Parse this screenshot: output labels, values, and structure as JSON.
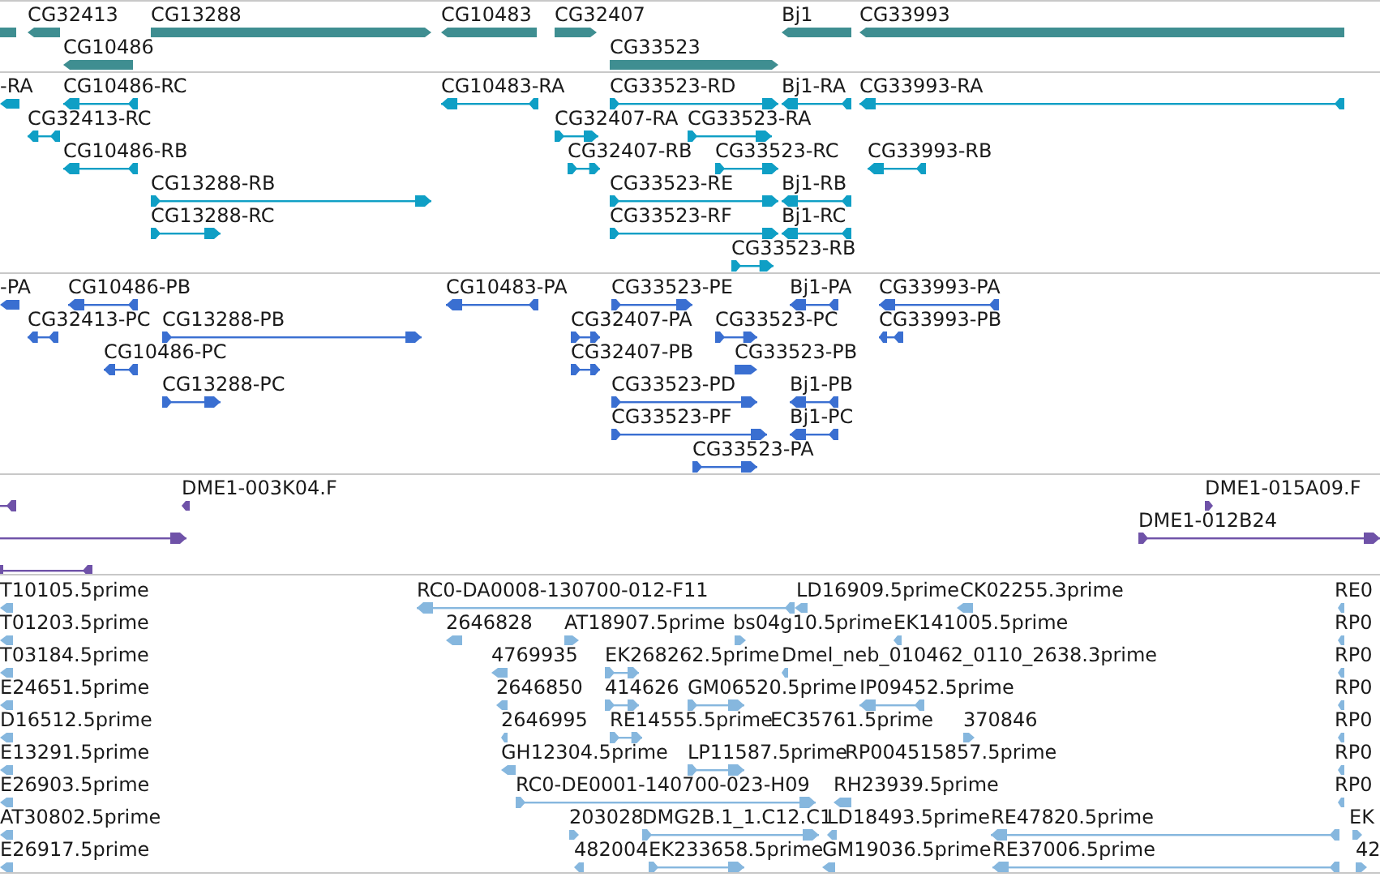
{
  "tracks": [
    {
      "kind": "genes",
      "color": "#3f8e91",
      "features": [
        {
          "clipped": true
        },
        {
          "label": "CG32413"
        },
        {
          "label": "CG13288"
        },
        {
          "label": "CG10483"
        },
        {
          "label": "CG32407"
        },
        {
          "label": "Bj1"
        },
        {
          "label": "CG33993"
        },
        {
          "label": "CG10486"
        },
        {
          "label": "CG33523"
        }
      ]
    },
    {
      "kind": "transcripts",
      "color": "#0f9fc5",
      "features": [
        {
          "label": "-RA"
        },
        {
          "label": "CG10486-RC"
        },
        {
          "label": "CG10483-RA"
        },
        {
          "label": "CG33523-RD"
        },
        {
          "label": "Bj1-RA"
        },
        {
          "label": "CG33993-RA"
        },
        {
          "label": "CG32413-RC"
        },
        {
          "label": "CG32407-RA"
        },
        {
          "label": "CG33523-RA"
        },
        {
          "label": "CG10486-RB"
        },
        {
          "label": "CG32407-RB"
        },
        {
          "label": "CG33523-RC"
        },
        {
          "label": "CG33993-RB"
        },
        {
          "label": "CG13288-RB"
        },
        {
          "label": "CG33523-RE"
        },
        {
          "label": "Bj1-RB"
        },
        {
          "label": "CG13288-RC"
        },
        {
          "label": "CG33523-RF"
        },
        {
          "label": "Bj1-RC"
        },
        {
          "label": "CG33523-RB"
        }
      ]
    },
    {
      "kind": "proteins",
      "color": "#3a6fd1",
      "features": [
        {
          "label": "-PA"
        },
        {
          "label": "CG10486-PB"
        },
        {
          "label": "CG10483-PA"
        },
        {
          "label": "CG33523-PE"
        },
        {
          "label": "Bj1-PA"
        },
        {
          "label": "CG33993-PA"
        },
        {
          "label": "CG32413-PC"
        },
        {
          "label": "CG13288-PB"
        },
        {
          "label": "CG32407-PA"
        },
        {
          "label": "CG33523-PC"
        },
        {
          "label": "CG33993-PB"
        },
        {
          "label": "CG10486-PC"
        },
        {
          "label": "CG32407-PB"
        },
        {
          "label": "CG33523-PB"
        },
        {
          "label": "CG13288-PC"
        },
        {
          "label": "CG33523-PD"
        },
        {
          "label": "Bj1-PB"
        },
        {
          "label": "CG33523-PF"
        },
        {
          "label": "Bj1-PC"
        },
        {
          "label": "CG33523-PA"
        }
      ]
    },
    {
      "kind": "clones",
      "color": "#6f52a8",
      "features": [
        {
          "clipped": true
        },
        {
          "label": "DME1-003K04.F"
        },
        {
          "label": "DME1-015A09.F"
        },
        {
          "clipped": true
        },
        {
          "label": "DME1-012B24"
        },
        {
          "clipped": true
        }
      ]
    },
    {
      "kind": "ests",
      "color": "#86b7de",
      "features": [
        {
          "label": "T10105.5prime"
        },
        {
          "label": "RC0-DA0008-130700-012-F11"
        },
        {
          "label": "LD16909.5prime"
        },
        {
          "label": "CK02255.3prime"
        },
        {
          "label": "RE0"
        },
        {
          "label": "T01203.5prime"
        },
        {
          "label": "2646828"
        },
        {
          "label": "AT18907.5prime"
        },
        {
          "label": "bs04g10.5prime"
        },
        {
          "label": "EK141005.5prime"
        },
        {
          "label": "RP0"
        },
        {
          "label": "T03184.5prime"
        },
        {
          "label": "4769935"
        },
        {
          "label": "EK268262.5prime"
        },
        {
          "label": "Dmel_neb_010462_0110_2638.3prime"
        },
        {
          "label": "RP0"
        },
        {
          "label": "E24651.5prime"
        },
        {
          "label": "2646850"
        },
        {
          "label": "414626"
        },
        {
          "label": "GM06520.5prime"
        },
        {
          "label": "IP09452.5prime"
        },
        {
          "label": "RP0"
        },
        {
          "label": "D16512.5prime"
        },
        {
          "label": "2646995"
        },
        {
          "label": "RE14555.5prime"
        },
        {
          "label": "EC35761.5prime"
        },
        {
          "label": "370846"
        },
        {
          "label": "RP0"
        },
        {
          "label": "E13291.5prime"
        },
        {
          "label": "GH12304.5prime"
        },
        {
          "label": "LP11587.5prime"
        },
        {
          "label": "RP004515857.5prime"
        },
        {
          "label": "RP0"
        },
        {
          "label": "E26903.5prime"
        },
        {
          "label": "RC0-DE0001-140700-023-H09"
        },
        {
          "label": "RH23939.5prime"
        },
        {
          "label": "RP0"
        },
        {
          "label": "AT30802.5prime"
        },
        {
          "label": "203028"
        },
        {
          "label": "DMG2B.1_1.C12.C1"
        },
        {
          "label": "LD18493.5prime"
        },
        {
          "label": "RE47820.5prime"
        },
        {
          "label": "EK"
        },
        {
          "label": "E26917.5prime"
        },
        {
          "label": "482004"
        },
        {
          "label": "EK233658.5prime"
        },
        {
          "label": "GM19036.5prime"
        },
        {
          "label": "RE37006.5prime"
        },
        {
          "label": "42"
        }
      ]
    }
  ]
}
